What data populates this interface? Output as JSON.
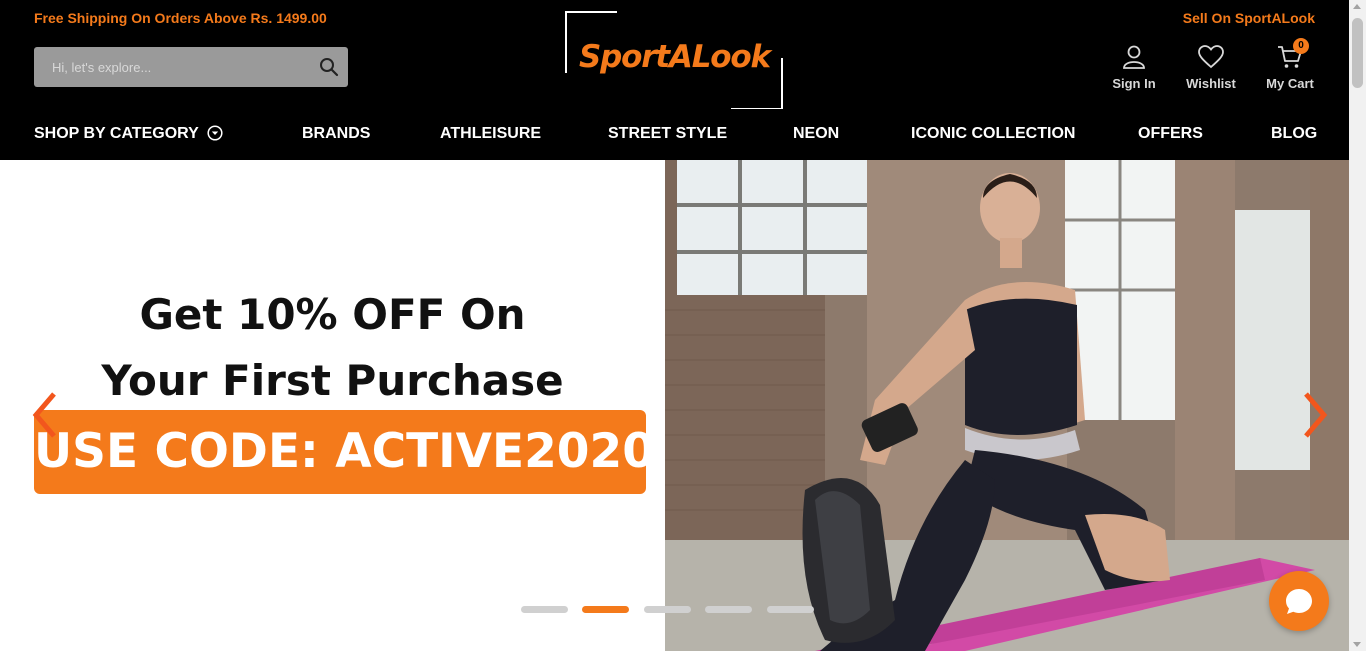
{
  "header": {
    "promo_text": "Free Shipping On Orders Above Rs. 1499.00",
    "sell_link": "Sell On SportALook",
    "search_placeholder": "Hi, let's explore...",
    "search_icon": "search-icon",
    "logo_text": "SportALook",
    "actions": {
      "sign_in": "Sign In",
      "wishlist": "Wishlist",
      "cart": "My Cart",
      "cart_count": "0"
    }
  },
  "nav": {
    "items": [
      "SHOP BY CATEGORY",
      "BRANDS",
      "ATHLEISURE",
      "STREET STYLE",
      "NEON",
      "ICONIC COLLECTION",
      "OFFERS",
      "BLOG"
    ]
  },
  "hero": {
    "headline_line1": "Get 10% OFF On",
    "headline_line2": "Your First Purchase",
    "code_text": "USE CODE: ACTIVE2020",
    "slide_count": 5,
    "active_slide": 2
  },
  "colors": {
    "accent": "#f47a1b",
    "header_bg": "#000000",
    "mat": "#d24aa6"
  },
  "icons": [
    "search-icon",
    "user-icon",
    "heart-icon",
    "cart-icon",
    "chevron-down-circle-icon",
    "chevron-left-icon",
    "chevron-right-icon",
    "chat-icon"
  ]
}
